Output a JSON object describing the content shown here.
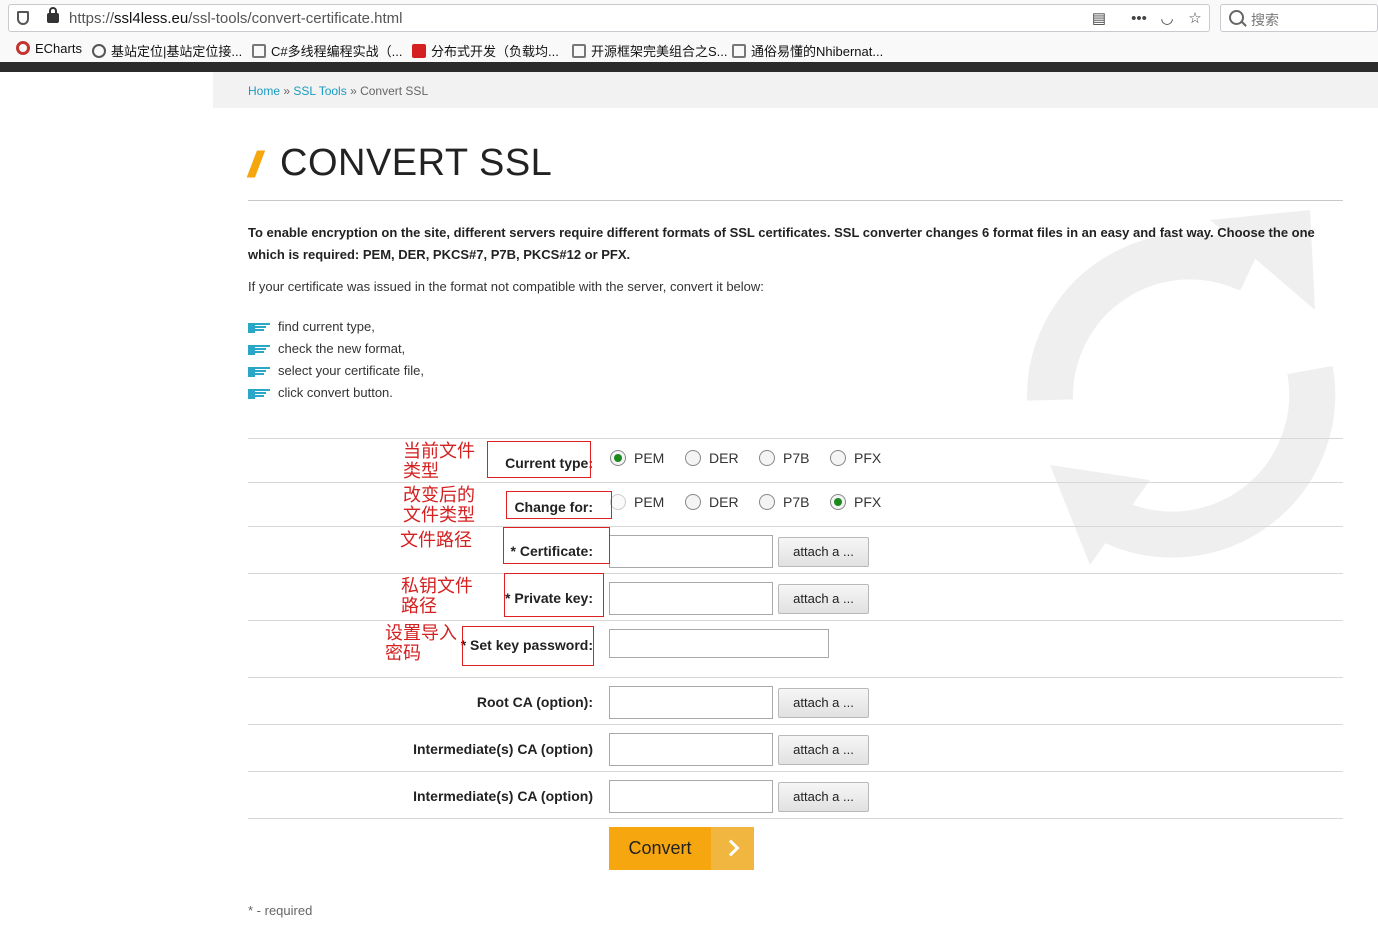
{
  "browser": {
    "url_prefix": "https://",
    "url_host": "ssl4less.eu",
    "url_path": "/ssl-tools/convert-certificate.html",
    "search_placeholder": "搜索",
    "bookmarks": [
      {
        "label": "ECharts"
      },
      {
        "label": "基站定位|基站定位接..."
      },
      {
        "label": "C#多线程编程实战（..."
      },
      {
        "label": "分布式开发（负载均..."
      },
      {
        "label": "开源框架完美组合之S..."
      },
      {
        "label": "通俗易懂的Nhibernat..."
      }
    ]
  },
  "breadcrumb": {
    "home": "Home",
    "sep1": " » ",
    "tools": "SSL Tools",
    "sep2": " » ",
    "current": "Convert SSL"
  },
  "page": {
    "title_slashes": "//",
    "title": "CONVERT SSL",
    "intro_bold": "To enable encryption on the site, different servers require different formats of SSL certificates. SSL converter changes 6 format files in an easy and fast way. Choose the one which is required: PEM, DER, PKCS#7, P7B, PKCS#12 or PFX.",
    "intro_plain": "If your certificate was issued in the format not compatible with the server, convert it below:",
    "steps": [
      "find current type,",
      "check the new format,",
      "select your certificate file,",
      "click convert button."
    ]
  },
  "form": {
    "current_type_label": "Current type:",
    "change_for_label": "Change for:",
    "formats": [
      "PEM",
      "DER",
      "P7B",
      "PFX"
    ],
    "current_type_selected": "PEM",
    "change_for_selected": "PFX",
    "certificate_label": "* Certificate:",
    "private_key_label": "* Private key:",
    "set_key_password_label": "* Set key password:",
    "root_ca_label": "Root CA (option):",
    "intermediate_ca_label_1": "Intermediate(s) CA (option)",
    "intermediate_ca_label_2": "Intermediate(s) CA (option)",
    "attach_label": "attach a ...",
    "convert_label": "Convert",
    "required_note": "* - required"
  },
  "annotations": {
    "current_type": [
      "当前文件",
      "类型"
    ],
    "change_for": [
      "改变后的",
      "文件类型"
    ],
    "certificate": [
      "文件路径"
    ],
    "private_key": [
      "私钥文件",
      "路径"
    ],
    "password": [
      "设置导入",
      "密码"
    ]
  },
  "colors": {
    "accent": "#f6a60f",
    "link": "#1b9bc2",
    "annotation": "#e02020",
    "radio_checked": "#1b8a1b"
  }
}
